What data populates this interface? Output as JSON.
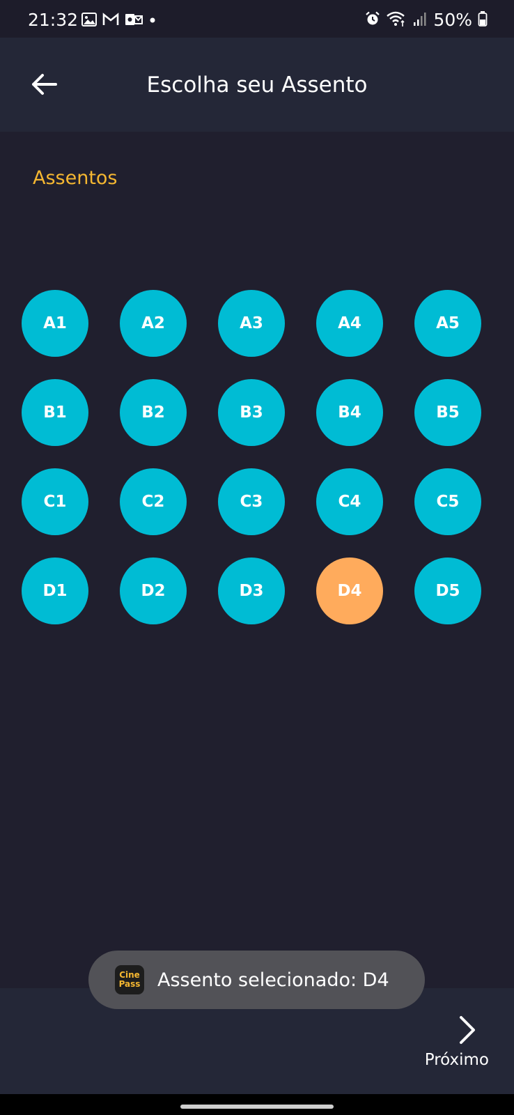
{
  "status_bar": {
    "time": "21:32",
    "battery": "50%",
    "left_icons": [
      "gallery-icon",
      "gmail-icon",
      "outlook-icon",
      "notification-dot-icon"
    ],
    "right_icons": [
      "alarm-icon",
      "wifi-icon",
      "signal-icon",
      "battery-icon"
    ]
  },
  "app_bar": {
    "title": "Escolha seu Assento",
    "back_icon": "arrow-left-icon"
  },
  "section": {
    "label": "Assentos"
  },
  "seats": {
    "rows": [
      [
        "A1",
        "A2",
        "A3",
        "A4",
        "A5"
      ],
      [
        "B1",
        "B2",
        "B3",
        "B4",
        "B5"
      ],
      [
        "C1",
        "C2",
        "C3",
        "C4",
        "C5"
      ],
      [
        "D1",
        "D2",
        "D3",
        "D4",
        "D5"
      ]
    ],
    "selected": "D4",
    "available_color": "#00bcd4",
    "selected_color": "#ffab5c"
  },
  "toast": {
    "logo_text_line1": "Cine",
    "logo_text_line2": "Pass",
    "message": "Assento selecionado: D4"
  },
  "bottom_bar": {
    "next_label": "Próximo",
    "next_icon": "chevron-right-icon"
  },
  "colors": {
    "background": "#201f2e",
    "bar": "#242737",
    "accent": "#f5b731"
  }
}
